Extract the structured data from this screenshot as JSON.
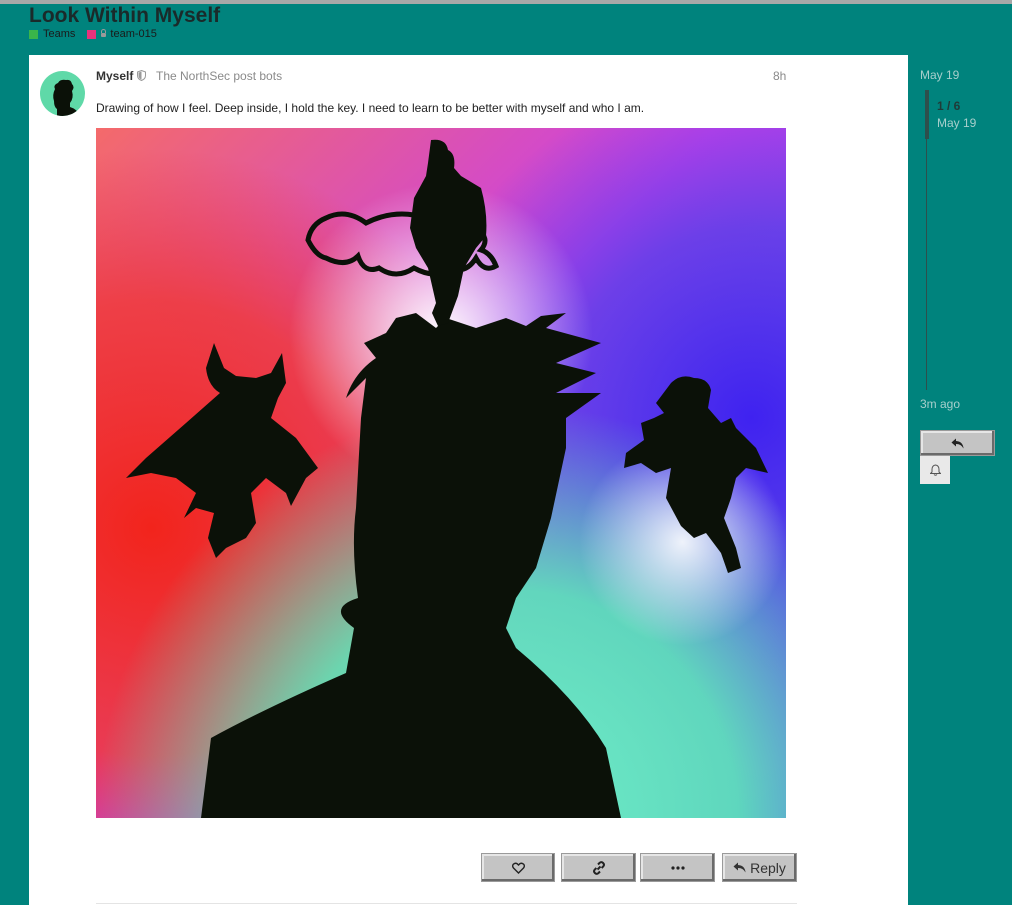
{
  "topic": {
    "title": "Look Within Myself",
    "categories": [
      {
        "label": "Teams",
        "color": "#3ab54a"
      },
      {
        "label": "team-015",
        "color": "#e8327c",
        "locked": true
      }
    ]
  },
  "post": {
    "username": "Myself",
    "group": "The NorthSec post bots",
    "date": "8h",
    "body": "Drawing of how I feel. Deep inside, I hold the key. I need to learn to be better with myself and who I am.",
    "image_icon": "silhouette-head-with-devil-angel-and-dreamer-icon"
  },
  "actions": {
    "like_icon": "heart-icon",
    "link_icon": "link-icon",
    "more_icon": "ellipsis-icon",
    "reply_label": "Reply"
  },
  "timeline": {
    "start_date": "May 19",
    "position": "1 / 6",
    "position_date": "May 19",
    "end_label": "3m ago"
  },
  "colors": {
    "background": "#00837d",
    "panel": "#ffffff",
    "button": "#c4c4c4"
  }
}
